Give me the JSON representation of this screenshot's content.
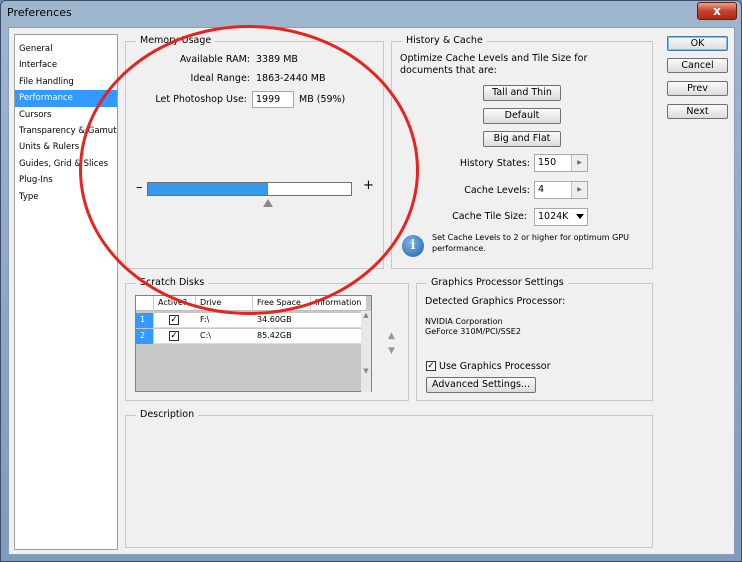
{
  "window": {
    "title": "Preferences",
    "close": "x"
  },
  "nav": {
    "items": [
      "General",
      "Interface",
      "File Handling",
      "Performance",
      "Cursors",
      "Transparency & Gamut",
      "Units & Rulers",
      "Guides, Grid & Slices",
      "Plug-Ins",
      "Type"
    ],
    "selected": "Performance"
  },
  "memory": {
    "title": "Memory Usage",
    "available_label": "Available RAM:",
    "available_value": "3389 MB",
    "ideal_label": "Ideal Range:",
    "ideal_value": "1863-2440 MB",
    "let_label": "Let Photoshop Use:",
    "let_value": "1999",
    "let_suffix": "MB (59%)",
    "minus": "–",
    "plus": "+",
    "slider_fraction": 0.59
  },
  "history": {
    "title": "History & Cache",
    "desc": "Optimize Cache Levels and Tile Size for documents that are:",
    "btn_tall": "Tall and Thin",
    "btn_default": "Default",
    "btn_big": "Big and Flat",
    "states_label": "History States:",
    "states_value": "150",
    "levels_label": "Cache Levels:",
    "levels_value": "4",
    "tile_label": "Cache Tile Size:",
    "tile_value": "1024K",
    "info": "Set Cache Levels to 2 or higher for optimum GPU performance."
  },
  "scratch": {
    "title": "Scratch Disks",
    "headers": [
      "",
      "Active?",
      "Drive",
      "Free Space",
      "Information"
    ],
    "rows": [
      {
        "num": "1",
        "drive": "F:\\",
        "free": "34.60GB",
        "info": ""
      },
      {
        "num": "2",
        "drive": "C:\\",
        "free": "85.42GB",
        "info": ""
      }
    ]
  },
  "gpu": {
    "title": "Graphics Processor Settings",
    "detected_label": "Detected Graphics Processor:",
    "vendor": "NVIDIA Corporation",
    "model": "GeForce 310M/PCI/SSE2",
    "use_label": "Use Graphics Processor",
    "advanced": "Advanced Settings..."
  },
  "description": {
    "title": "Description"
  },
  "buttons": {
    "ok": "OK",
    "cancel": "Cancel",
    "prev": "Prev",
    "next": "Next"
  },
  "colors": {
    "selection": "#3399ff",
    "annotation": "#e8221f"
  }
}
